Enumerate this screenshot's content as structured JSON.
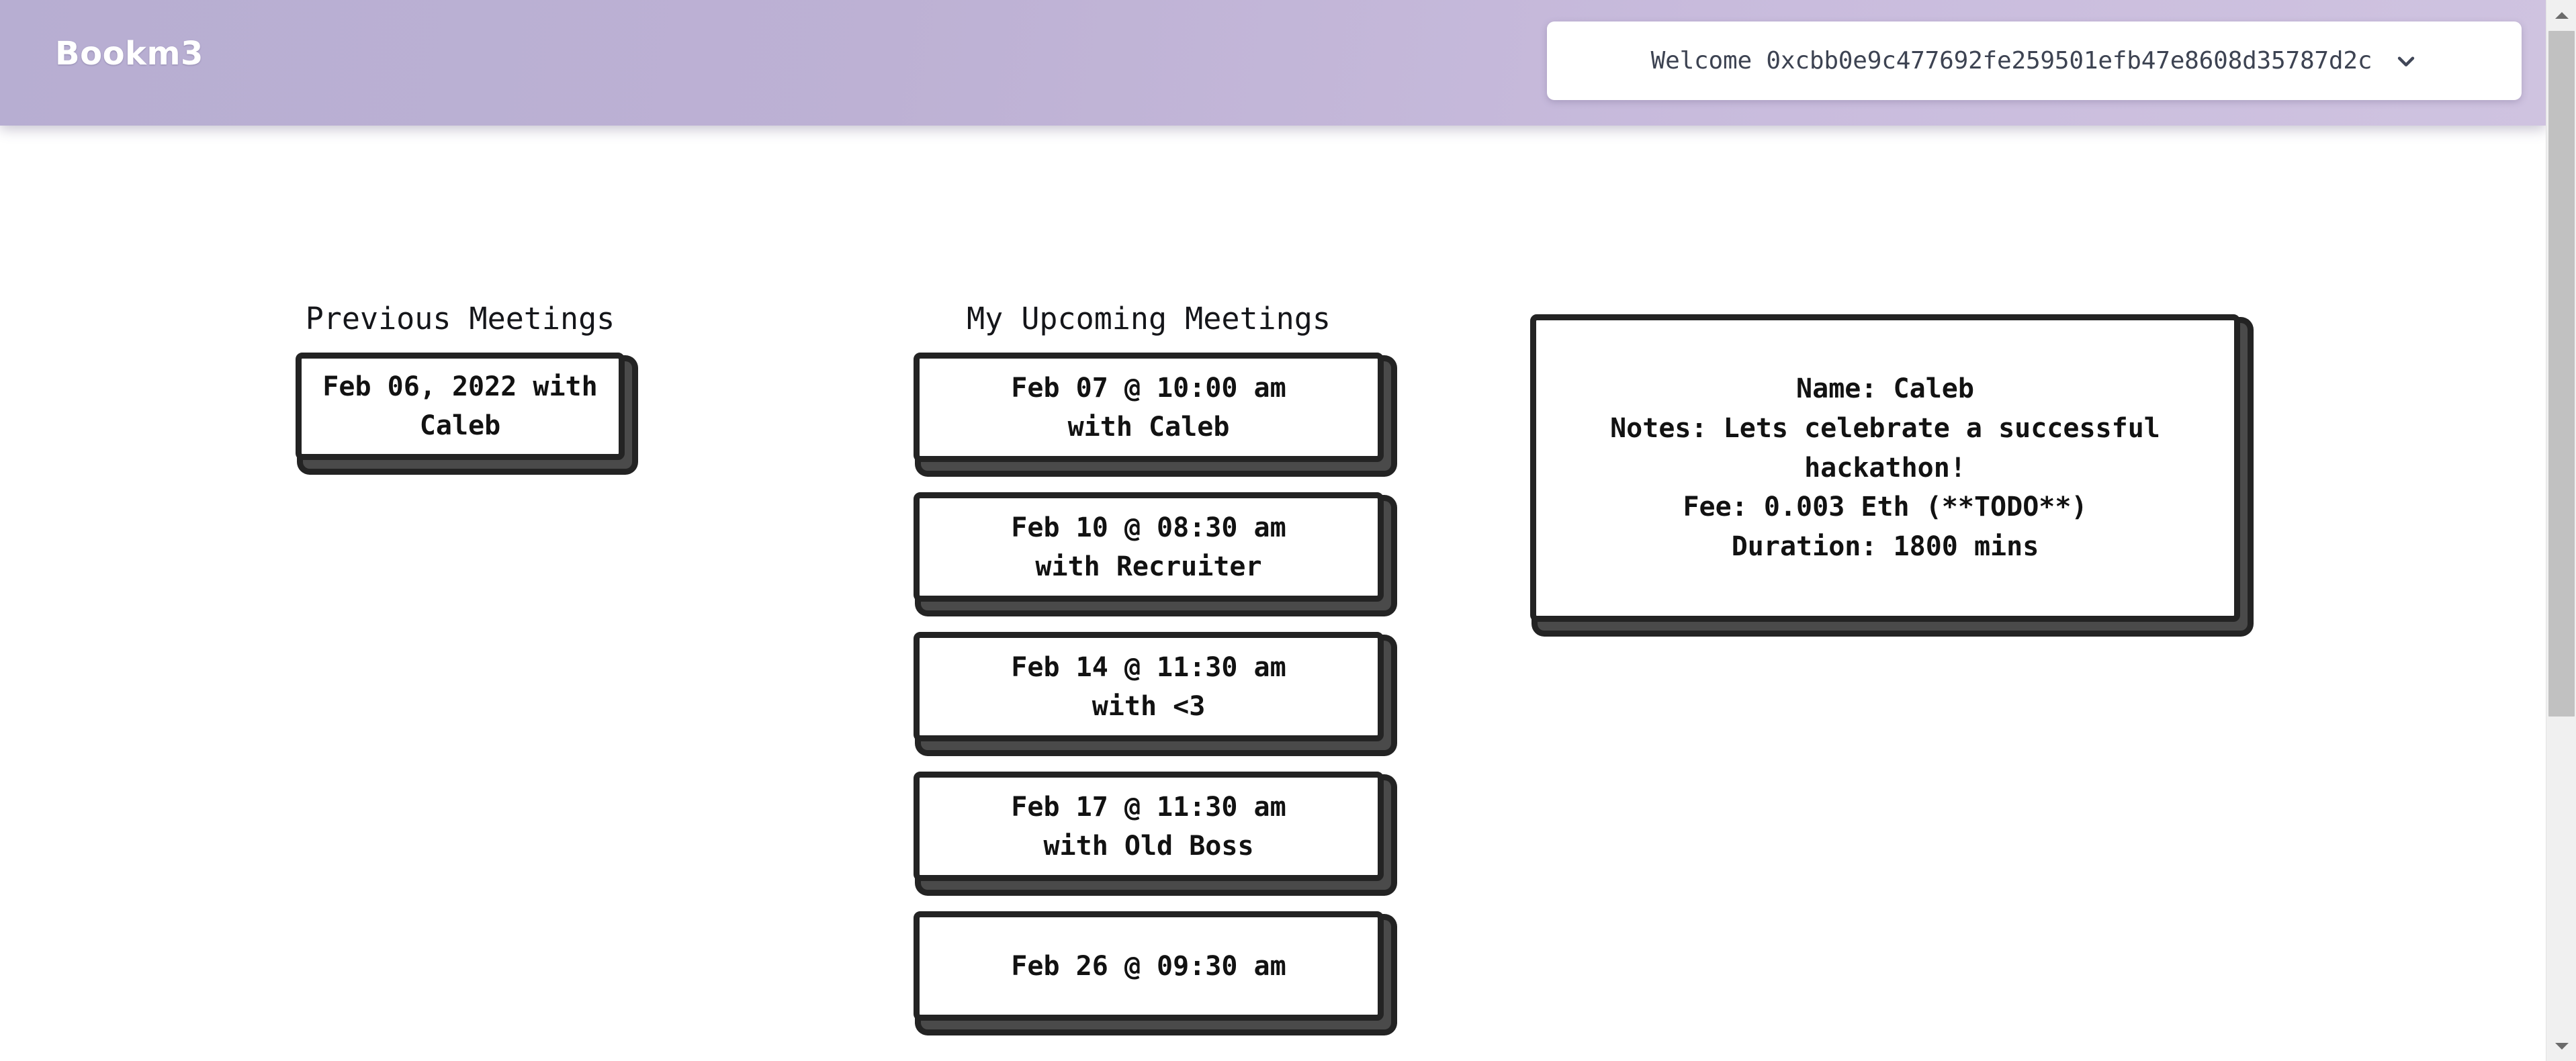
{
  "header": {
    "brand": "Bookm3",
    "wallet": {
      "welcome_text": "Welcome 0xcbb0e9c477692fe259501efb47e8608d35787d2c",
      "address": "0xcbb0e9c477692fe259501efb47e8608d35787d2c",
      "chevron_icon": "chevron-down-icon"
    },
    "gradient_from": "#b7aed2",
    "gradient_to": "#cfc3e0"
  },
  "previous": {
    "title": "Previous Meetings",
    "meetings": [
      {
        "line1": "Feb 06, 2022 with",
        "line2": "Caleb"
      }
    ]
  },
  "upcoming": {
    "title": "My Upcoming Meetings",
    "meetings": [
      {
        "line1": "Feb 07 @ 10:00 am",
        "line2": "with Caleb"
      },
      {
        "line1": "Feb 10 @ 08:30 am",
        "line2": "with Recruiter"
      },
      {
        "line1": "Feb 14 @ 11:30 am",
        "line2": "with <3"
      },
      {
        "line1": "Feb 17 @ 11:30 am",
        "line2": "with Old Boss"
      },
      {
        "line1": "Feb 26 @ 09:30 am",
        "line2": ""
      }
    ]
  },
  "details": {
    "name": "Name: Caleb",
    "notes": "Notes: Lets celebrate a successful hackathon!",
    "fee": "Fee: 0.003 Eth (**TODO**)",
    "duration": "Duration: 1800 mins"
  },
  "scrollbar": {
    "up_icon": "scroll-up-arrow-icon",
    "down_icon": "scroll-down-arrow-icon"
  },
  "theme": {
    "card_border": "#232323",
    "card_shadow": "#4a4a4a",
    "text": "#121212",
    "accent": "#b7aed2"
  }
}
